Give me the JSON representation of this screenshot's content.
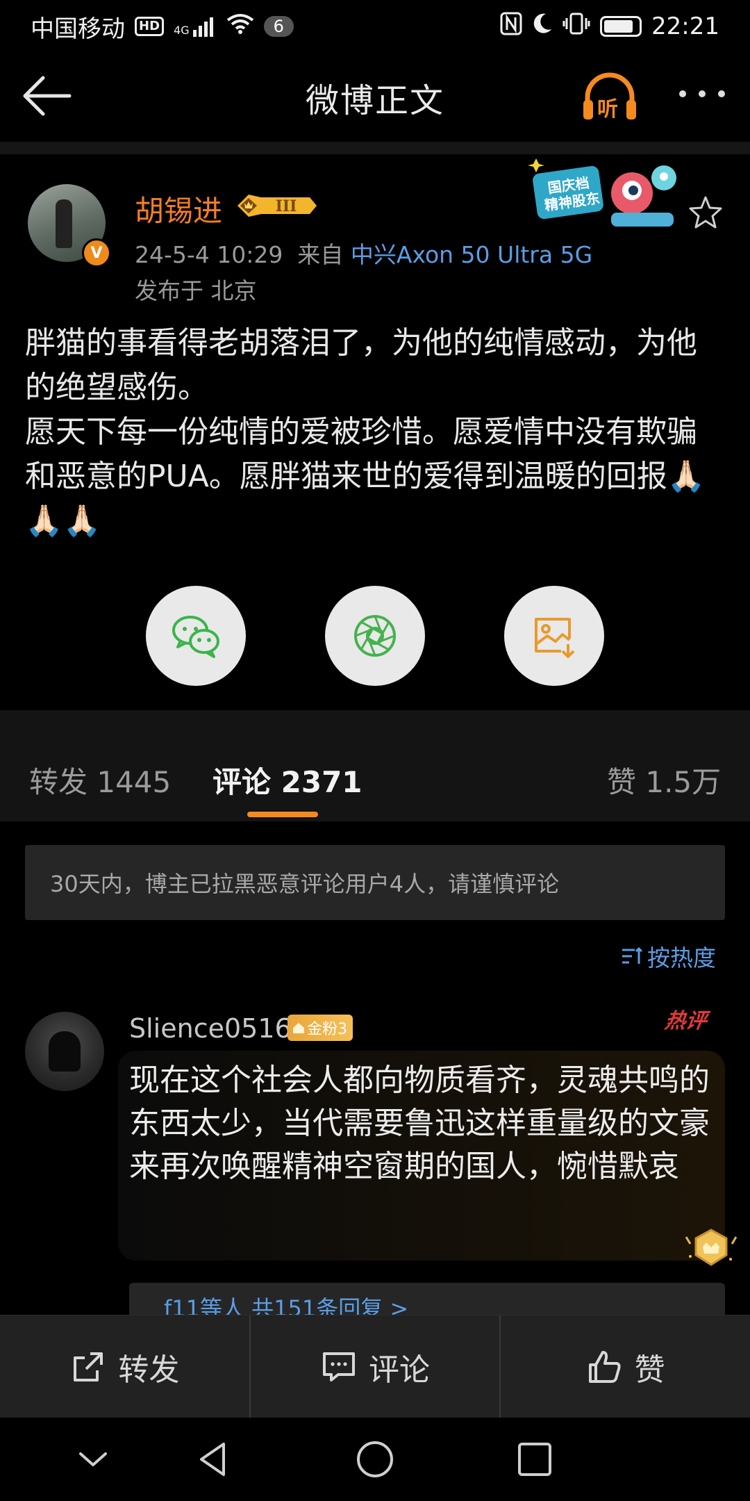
{
  "status_bar": {
    "carrier": "中国移动",
    "hd": "HD",
    "network": "4G",
    "notification_count": "6",
    "time": "22:21",
    "battery_level": 0.85
  },
  "nav": {
    "title": "微博正文",
    "listen_label": "听"
  },
  "post": {
    "author": "胡锡进",
    "level_badge": "III",
    "verified_mark": "V",
    "date": "24-5-4 10:29",
    "from_prefix": "来自",
    "device": "中兴Axon 50 Ultra 5G",
    "location": "发布于 北京",
    "body_line1": "胖猫的事看得老胡落泪了，为他的纯情感动，为他的绝望感伤。",
    "body_line2": "愿天下每一份纯情的爱被珍惜。愿爱情中没有欺骗和恶意的PUA。愿胖猫来世的爱得到温暖的回报🙏🏻🙏🏻🙏🏻",
    "sticker_text": "国庆档精神股东"
  },
  "share": {
    "wechat_icon": "wechat-icon",
    "moments_icon": "moments-icon",
    "save_image_icon": "save-image-icon"
  },
  "tabs": {
    "repost": "转发 1445",
    "comments": "评论 2371",
    "likes": "赞 1.5万"
  },
  "notice": "30天内，博主已拉黑恶意评论用户4人，请谨慎评论",
  "sort_label": "按热度",
  "comment": {
    "user": "Slience0516",
    "fan_badge": "金粉3",
    "hot_tag": "热评",
    "text": "现在这个社会人都向物质看齐，灵魂共鸣的东西太少，当代需要鲁迅这样重量级的文豪来再次唤醒精神空窗期的国人，惋惜默哀",
    "reply_preview": "f11等人 共151条回复 >"
  },
  "actions": {
    "repost": "转发",
    "comment": "评论",
    "like": "赞"
  },
  "colors": {
    "accent_orange": "#f47e23",
    "link_blue": "#5a9ee6",
    "hot_red": "#e23a3a"
  }
}
